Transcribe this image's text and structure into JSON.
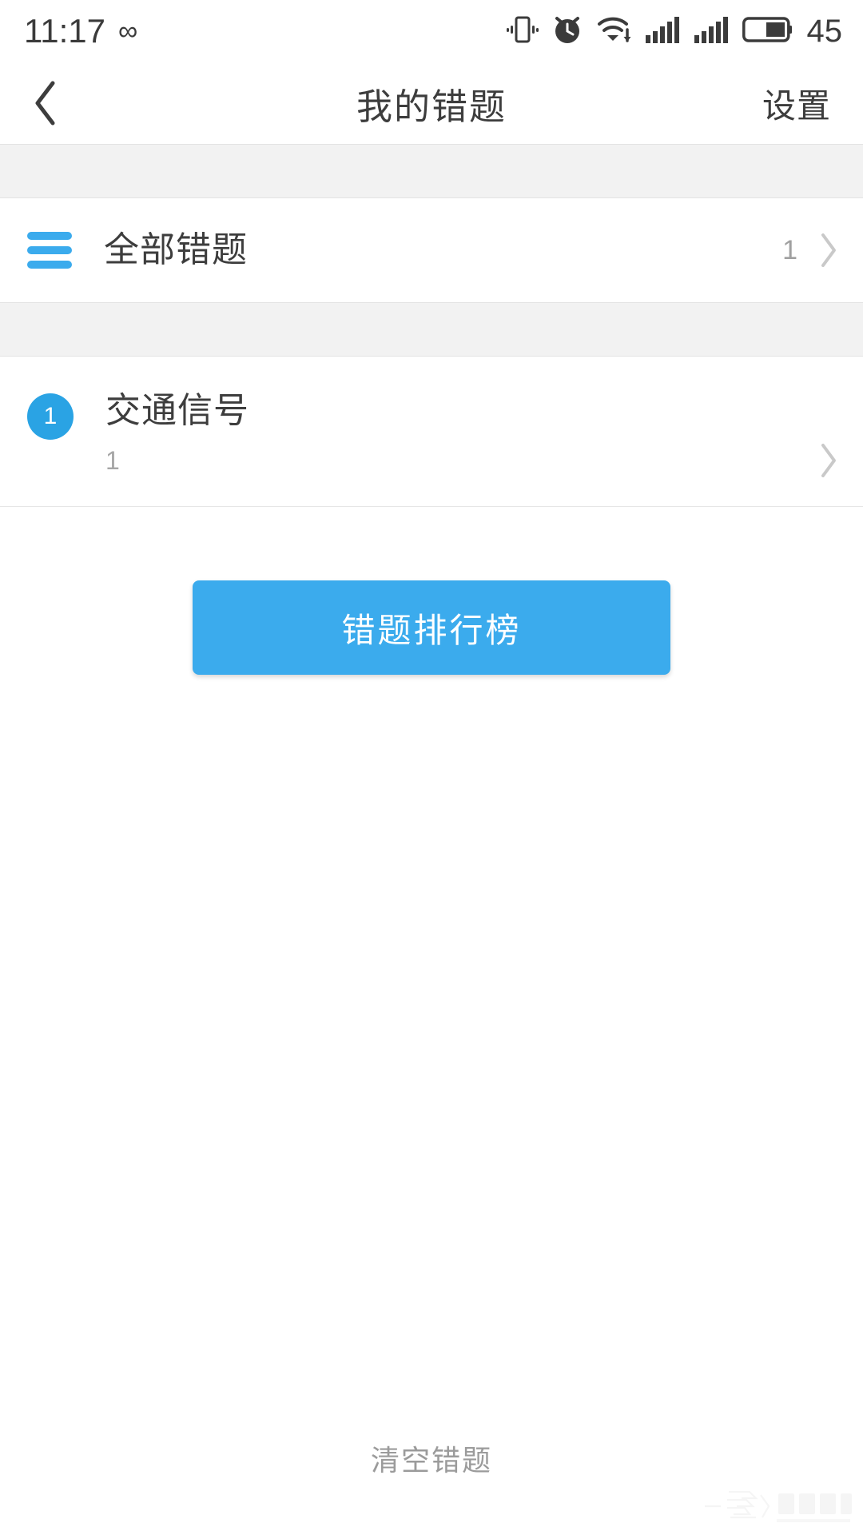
{
  "status_bar": {
    "time": "11:17",
    "infinity_glyph": "∞",
    "battery_percent": "45",
    "icons": [
      "vibrate-icon",
      "alarm-icon",
      "wifi-icon",
      "signal-icon-sim1",
      "signal-icon-sim2",
      "battery-icon"
    ]
  },
  "header": {
    "back_glyph": "‹",
    "title": "我的错题",
    "action_label": "设置"
  },
  "list": {
    "all_row": {
      "icon": "hamburger-icon",
      "title": "全部错题",
      "count": "1",
      "chevron": "›"
    },
    "categories": [
      {
        "badge": "1",
        "title": "交通信号",
        "subtitle": "1",
        "chevron": "›"
      }
    ]
  },
  "primary_button": {
    "label": "错题排行榜"
  },
  "footer": {
    "clear_label": "清空错题",
    "watermark_text": "系统之家"
  },
  "colors": {
    "accent": "#3babed",
    "badge": "#2aa3e4",
    "text_primary": "#3d3d3d",
    "text_muted": "#a0a0a0",
    "band": "#f2f2f2"
  }
}
